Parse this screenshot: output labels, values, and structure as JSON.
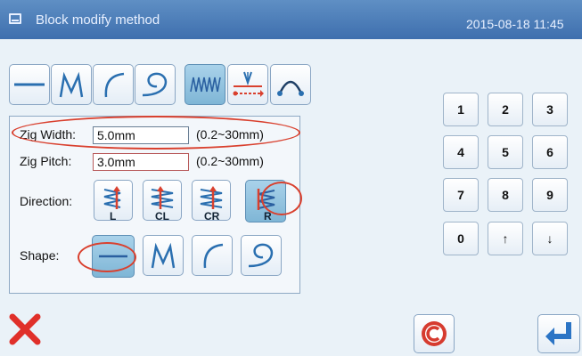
{
  "window": {
    "title": "Block modify method",
    "datetime": "2015-08-18 11:45",
    "icon": "window-icon"
  },
  "toolbar": {
    "items": [
      {
        "name": "straight-line",
        "icon": "straight-line-icon"
      },
      {
        "name": "zigzag",
        "icon": "zigzag-icon"
      },
      {
        "name": "arc",
        "icon": "arc-icon"
      },
      {
        "name": "curve",
        "icon": "curve-icon"
      },
      {
        "name": "zigzag-stitch",
        "icon": "zigzag-stitch-icon",
        "selected": true
      },
      {
        "name": "needle-feed",
        "icon": "needle-feed-icon"
      },
      {
        "name": "point-arc",
        "icon": "point-arc-icon"
      }
    ]
  },
  "form": {
    "zig_width": {
      "label": "Zig Width:",
      "value": "5.0mm",
      "range": "(0.2~30mm)"
    },
    "zig_pitch": {
      "label": "Zig Pitch:",
      "value": "3.0mm",
      "range": "(0.2~30mm)"
    },
    "direction": {
      "label": "Direction:",
      "options": [
        {
          "label": "L",
          "icon": "direction-left-icon"
        },
        {
          "label": "CL",
          "icon": "direction-center-left-icon"
        },
        {
          "label": "CR",
          "icon": "direction-center-right-icon"
        },
        {
          "label": "R",
          "icon": "direction-right-icon",
          "selected": true
        }
      ]
    },
    "shape": {
      "label": "Shape:",
      "options": [
        {
          "name": "straight",
          "icon": "straight-line-icon",
          "selected": true
        },
        {
          "name": "zigzag",
          "icon": "zigzag-icon"
        },
        {
          "name": "arc",
          "icon": "arc-icon"
        },
        {
          "name": "curve",
          "icon": "curve-icon"
        }
      ]
    }
  },
  "keypad": {
    "keys": [
      "1",
      "2",
      "3",
      "4",
      "5",
      "6",
      "7",
      "8",
      "9",
      "0",
      "↑",
      "↓"
    ]
  },
  "bottom": {
    "cancel_icon": "cancel-x-icon",
    "clear_icon": "clear-c-icon",
    "enter_icon": "enter-return-icon"
  },
  "colors": {
    "titlebar": "#4a7db8",
    "selected": "#8fc3e0",
    "annotation": "#d9402e",
    "cancel": "#e0302a"
  }
}
